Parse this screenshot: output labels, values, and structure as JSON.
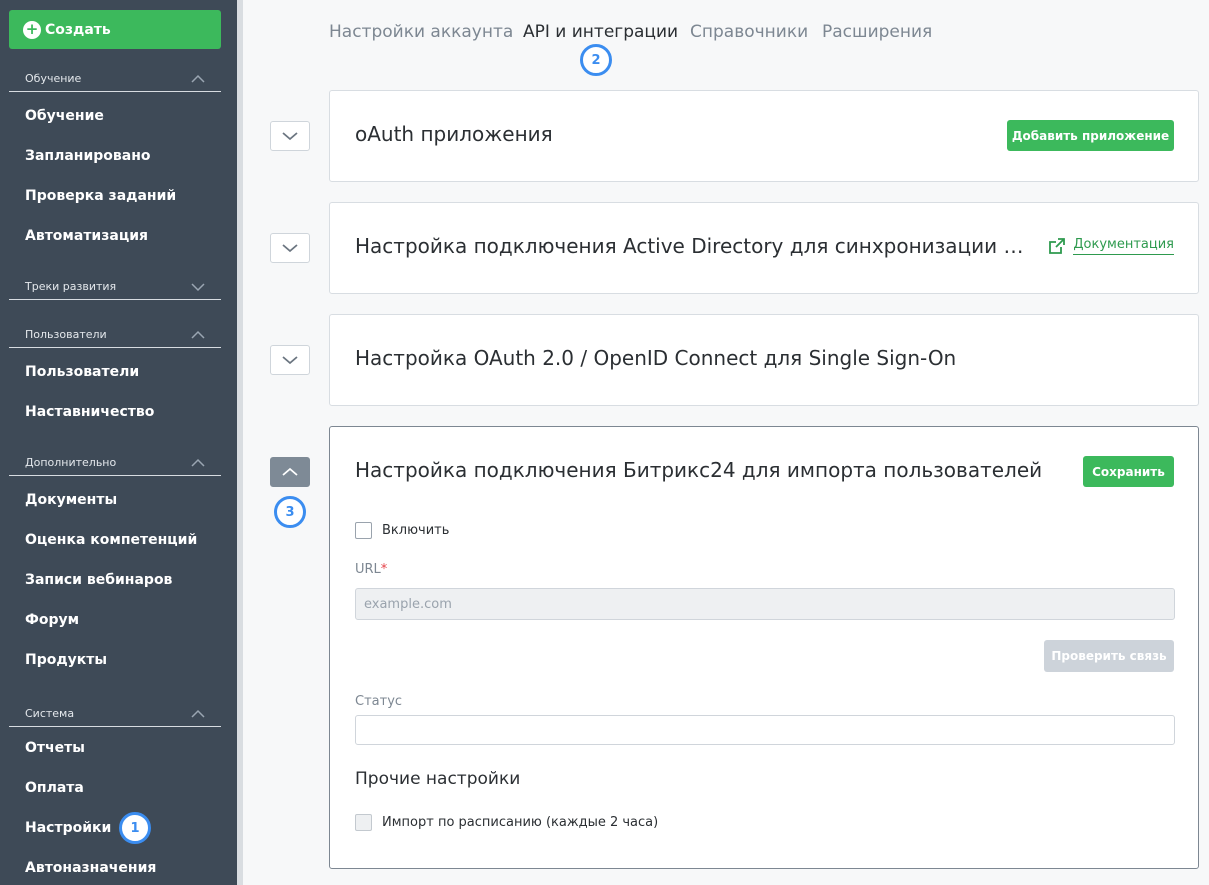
{
  "sidebar": {
    "create_label": "Создать",
    "sections": [
      {
        "title": "Обучение",
        "items": [
          "Обучение",
          "Запланировано",
          "Проверка заданий",
          "Автоматизация"
        ]
      },
      {
        "title": "Треки развития",
        "items": []
      },
      {
        "title": "Пользователи",
        "items": [
          "Пользователи",
          "Наставничество"
        ]
      },
      {
        "title": "Дополнительно",
        "items": [
          "Документы",
          "Оценка компетенций",
          "Записи вебинаров",
          "Форум",
          "Продукты"
        ]
      },
      {
        "title": "Система",
        "items": [
          "Отчеты",
          "Оплата",
          "Настройки",
          "Автоназначения"
        ]
      }
    ]
  },
  "badges": {
    "one": "1",
    "two": "2",
    "three": "3"
  },
  "tabs": [
    "Настройки аккаунта",
    "API и интеграции",
    "Справочники",
    "Расширения"
  ],
  "cards": {
    "oauth": {
      "title": "oAuth приложения",
      "button": "Добавить приложение"
    },
    "ad": {
      "title": "Настройка подключения Active Directory для синхронизации …",
      "link": "Документация"
    },
    "sso": {
      "title": "Настройка OAuth 2.0 / OpenID Connect для Single Sign-On"
    },
    "bitrix": {
      "title": "Настройка подключения Битрикс24 для импорта пользователей",
      "save": "Сохранить",
      "enable_label": "Включить",
      "url_label": "URL",
      "url_required": "*",
      "url_placeholder": "example.com",
      "check_button": "Проверить связь",
      "status_label": "Статус",
      "other_title": "Прочие настройки",
      "schedule_label": "Импорт по расписанию (каждые 2 часа)"
    }
  },
  "colors": {
    "sidebar": "#3e4a57",
    "accent": "#3cb95c",
    "badge": "#3b8df0"
  }
}
